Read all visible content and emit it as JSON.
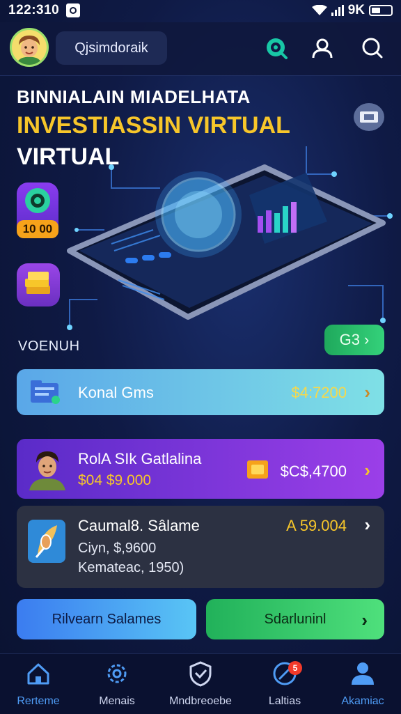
{
  "status_bar": {
    "time": "122:310",
    "battery": "9K"
  },
  "header": {
    "username": "Qjsimdoraik"
  },
  "hero": {
    "line1": "BINNIALAIN MIADELHATA",
    "line2": "INVESTIASSIN VIRTUAL",
    "line3": "VIRTUAL",
    "side_badge": "10 00"
  },
  "section": {
    "label": "VOENUH",
    "go_button": "G3"
  },
  "cards": [
    {
      "title": "Konal Gms",
      "value": "$4:7200"
    },
    {
      "title": "RolA SIk Gatlalina",
      "subvalue": "$04 $9.000",
      "value": "$C$,4700"
    },
    {
      "title": "Caumal8. Sâlame",
      "line2": "Ciyn, $,9600",
      "line3": "Kemateac, 1950)",
      "value": "A 59.004"
    }
  ],
  "buttons": {
    "left": "Rilvearn Salames",
    "right": "Sdarluninl"
  },
  "nav": [
    {
      "label": "Rerteme",
      "active": true
    },
    {
      "label": "Menais",
      "active": false
    },
    {
      "label": "Mndbreoebe",
      "active": false
    },
    {
      "label": "Laltias",
      "active": false,
      "badge": "5"
    },
    {
      "label": "Akamiac",
      "active": true
    }
  ],
  "colors": {
    "accent": "#4f9cf5",
    "gold": "#f7c62a",
    "green": "#34d17a",
    "purple": "#9b3fe8"
  }
}
